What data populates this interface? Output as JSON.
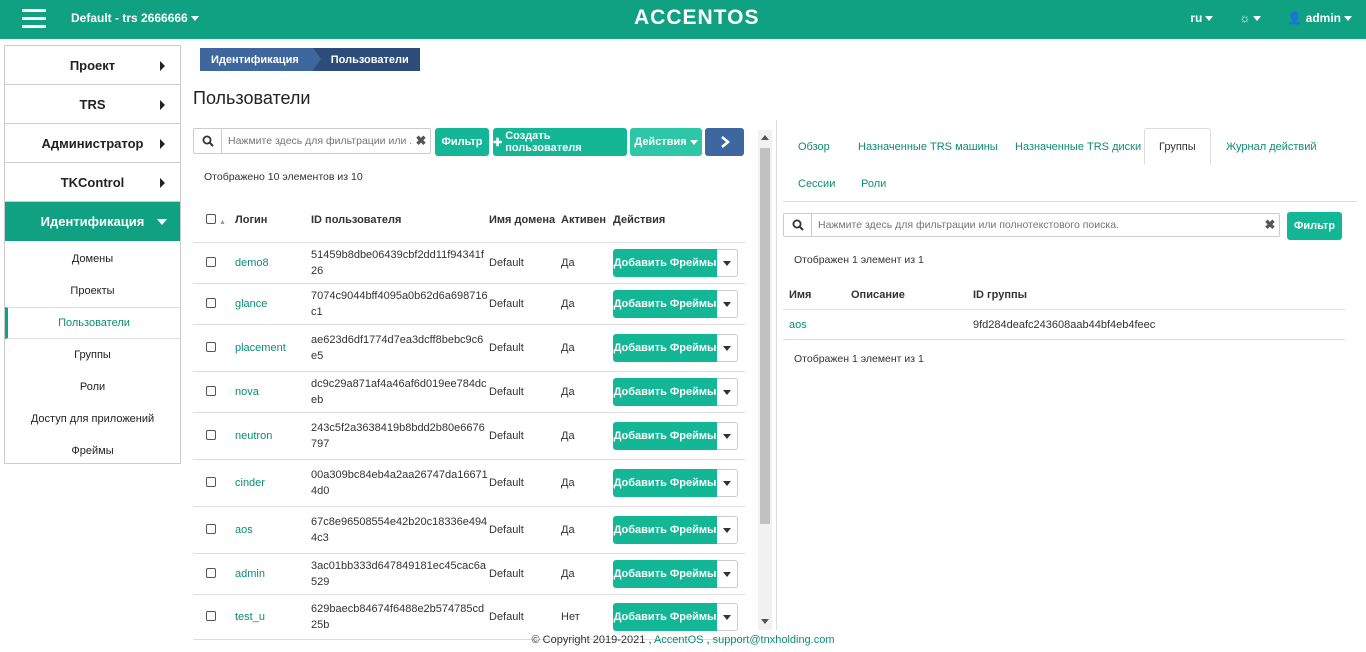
{
  "topbar": {
    "project": "Default - trs 2666666",
    "logo": "ACCENTOS",
    "lang": "ru",
    "user": "admin"
  },
  "sidebar": {
    "items": [
      {
        "label": "Проект"
      },
      {
        "label": "TRS"
      },
      {
        "label": "Администратор"
      },
      {
        "label": "TKControl"
      },
      {
        "label": "Идентификация"
      }
    ],
    "sub": [
      "Домены",
      "Проекты",
      "Пользователи",
      "Группы",
      "Роли",
      "Доступ для приложений",
      "Фреймы"
    ]
  },
  "breadcrumb": [
    "Идентификация",
    "Пользователи"
  ],
  "page_title": "Пользователи",
  "left": {
    "search_placeholder": "Нажмите здесь для фильтрации или ...",
    "filter_btn": "Фильтр",
    "create_btn": "Создать пользователя",
    "actions_btn": "Действия",
    "count": "Отображено 10 элементов из 10",
    "headers": {
      "login": "Логин",
      "id": "ID пользователя",
      "domain": "Имя домена",
      "active": "Активен",
      "actions": "Действия"
    },
    "row_btn": "Добавить Фреймы",
    "rows": [
      {
        "login": "demo8",
        "id": "51459b8dbe06439cbf2dd11f94341f26",
        "domain": "Default",
        "active": "Да"
      },
      {
        "login": "glance",
        "id": "7074c9044bff4095a0b62d6a698716c1",
        "domain": "Default",
        "active": "Да"
      },
      {
        "login": "placement",
        "id": "ae623d6df1774d7ea3dcff8bebc9c6e5",
        "domain": "Default",
        "active": "Да"
      },
      {
        "login": "nova",
        "id": "dc9c29a871af4a46af6d019ee784dceb",
        "domain": "Default",
        "active": "Да"
      },
      {
        "login": "neutron",
        "id": "243c5f2a3638419b8bdd2b80e6676797",
        "domain": "Default",
        "active": "Да"
      },
      {
        "login": "cinder",
        "id": "00a309bc84eb4a2aa26747da166714d0",
        "domain": "Default",
        "active": "Да"
      },
      {
        "login": "aos",
        "id": "67c8e96508554e42b20c18336e4944c3",
        "domain": "Default",
        "active": "Да"
      },
      {
        "login": "admin",
        "id": "3ac01bb333d647849181ec45cac6a529",
        "domain": "Default",
        "active": "Да"
      },
      {
        "login": "test_u",
        "id": "629baecb84674f6488e2b574785cd25b",
        "domain": "Default",
        "active": "Нет"
      }
    ]
  },
  "right": {
    "tabs": [
      "Обзор",
      "Назначенные TRS машины",
      "Назначенные TRS диски",
      "Группы",
      "Журнал действий",
      "Сессии",
      "Роли"
    ],
    "search_placeholder": "Нажмите здесь для фильтрации или полнотекстового поиска.",
    "filter_btn": "Фильтр",
    "count_top": "Отображен 1 элемент из 1",
    "count_bottom": "Отображен 1 элемент из 1",
    "headers": {
      "name": "Имя",
      "desc": "Описание",
      "gid": "ID группы"
    },
    "rows": [
      {
        "name": "aos",
        "desc": "",
        "gid": "9fd284deafc243608aab44bf4eb4feec"
      }
    ]
  },
  "footer": {
    "copyright": "© Copyright 2019-2021 ,",
    "brand": "AccentOS",
    "sep": ",",
    "email": "support@tnxholding.com"
  }
}
